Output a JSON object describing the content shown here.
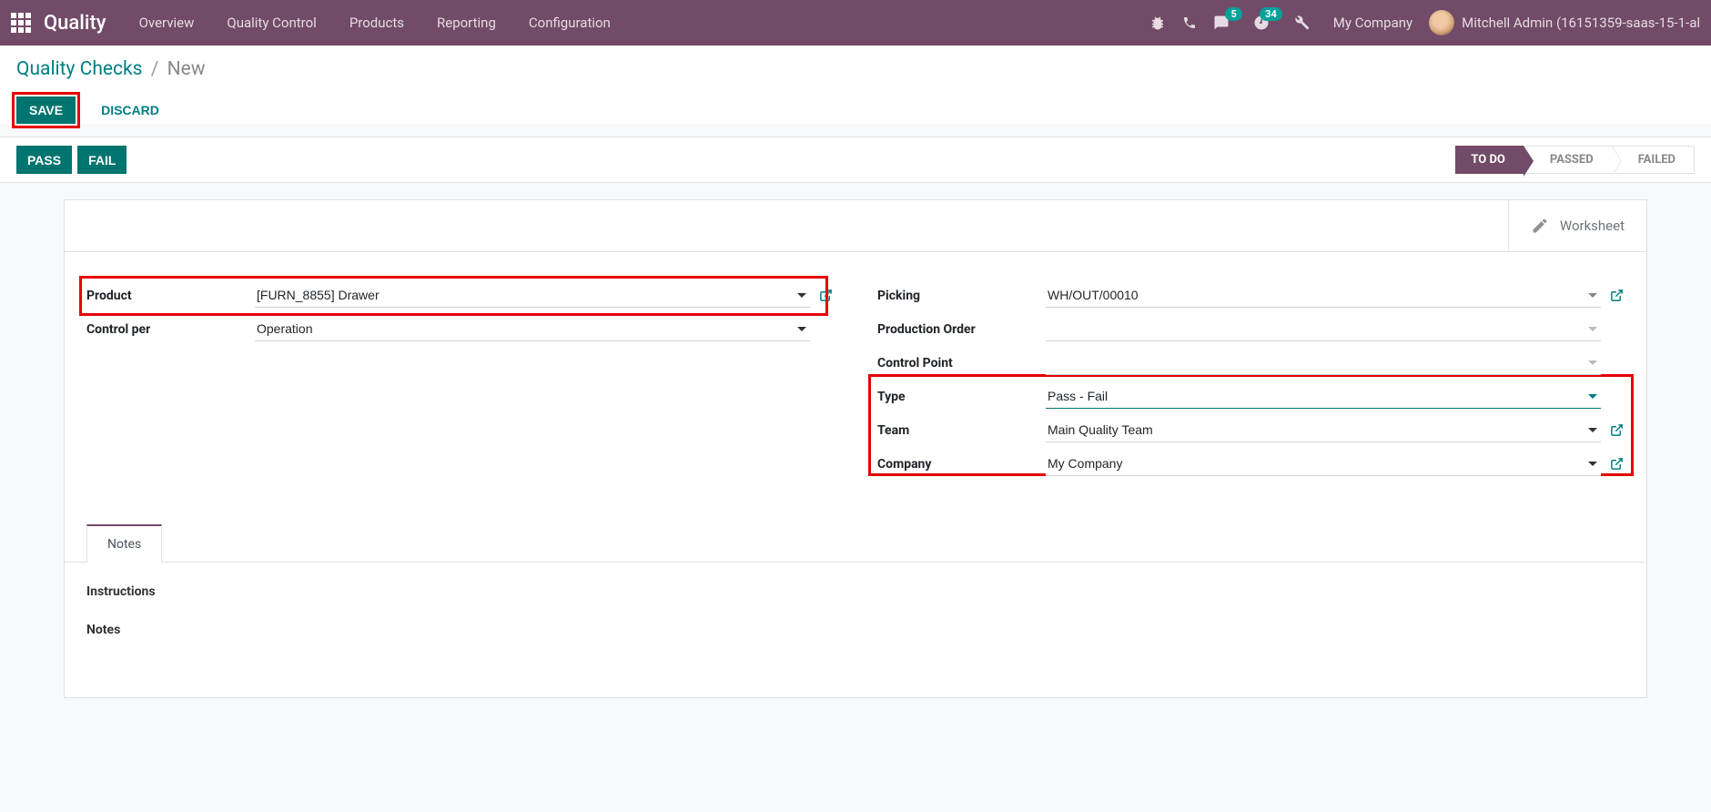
{
  "navbar": {
    "brand": "Quality",
    "items": [
      "Overview",
      "Quality Control",
      "Products",
      "Reporting",
      "Configuration"
    ],
    "messages_badge": "5",
    "activities_badge": "34",
    "company": "My Company",
    "user": "Mitchell Admin (16151359-saas-15-1-al"
  },
  "breadcrumb": {
    "root": "Quality Checks",
    "current": "New"
  },
  "buttons": {
    "save": "SAVE",
    "discard": "DISCARD",
    "pass": "PASS",
    "fail": "FAIL"
  },
  "status_steps": [
    "TO DO",
    "PASSED",
    "FAILED"
  ],
  "header_btn": {
    "worksheet": "Worksheet"
  },
  "form": {
    "left": {
      "product_label": "Product",
      "product_value": "[FURN_8855] Drawer",
      "control_per_label": "Control per",
      "control_per_value": "Operation"
    },
    "right": {
      "picking_label": "Picking",
      "picking_value": "WH/OUT/00010",
      "production_order_label": "Production Order",
      "production_order_value": "",
      "control_point_label": "Control Point",
      "control_point_value": "",
      "type_label": "Type",
      "type_value": "Pass - Fail",
      "team_label": "Team",
      "team_value": "Main Quality Team",
      "company_label": "Company",
      "company_value": "My Company"
    }
  },
  "tabs": {
    "notes": "Notes",
    "instructions_label": "Instructions",
    "notes_label": "Notes"
  }
}
